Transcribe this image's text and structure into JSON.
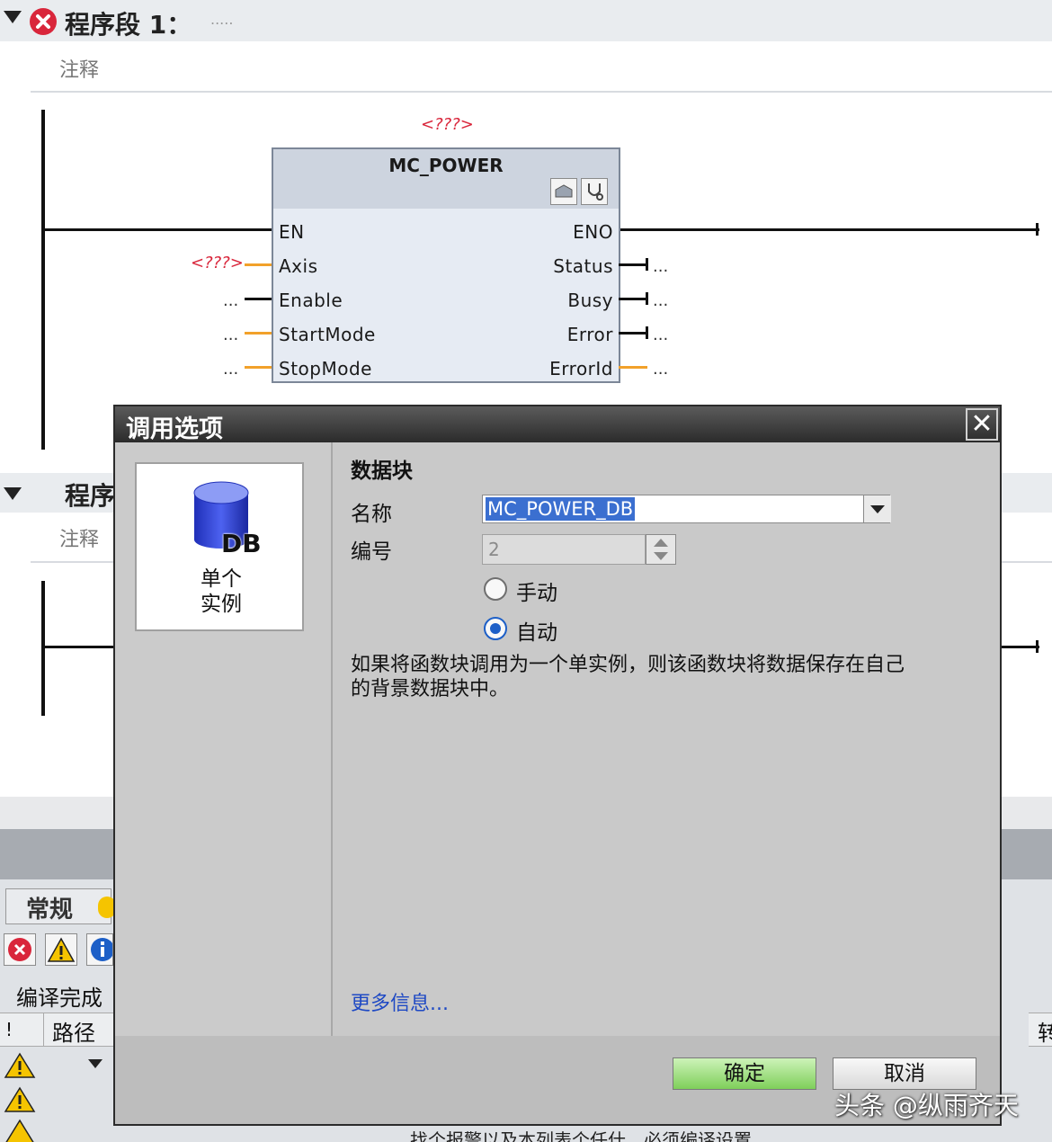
{
  "segment1": {
    "title": "程序段 1：",
    "ellipsis": ".....",
    "comment": "注释"
  },
  "segment2": {
    "title": "程序",
    "comment": "注释"
  },
  "block": {
    "instance_placeholder": "<???>",
    "name": "MC_POWER",
    "inputs": [
      "EN",
      "Axis",
      "Enable",
      "StartMode",
      "StopMode"
    ],
    "outputs": [
      "ENO",
      "Status",
      "Busy",
      "Error",
      "ErrorId"
    ],
    "axis_value": "<???>",
    "input_values": [
      "...",
      "...",
      "..."
    ],
    "output_values": [
      "...",
      "...",
      "...",
      "..."
    ]
  },
  "dialog": {
    "title": "调用选项",
    "close_label": "✕",
    "tile_label_line1": "单个",
    "tile_label_line2": "实例",
    "db_text": "DB",
    "section_title": "数据块",
    "name_label": "名称",
    "name_value": "MC_POWER_DB",
    "number_label": "编号",
    "number_value": "2",
    "manual_label": "手动",
    "auto_label": "自动",
    "selected_mode": "auto",
    "description_line1": "如果将函数块调用为一个单实例，则该函数块将数据保存在自己",
    "description_line2": "的背景数据块中。",
    "more_info": "更多信息...",
    "ok_label": "确定",
    "cancel_label": "取消"
  },
  "inspector": {
    "tab_general": "常规",
    "compile_done": "编译完成",
    "col_bang": "!",
    "col_path": "路径",
    "right_cut": "转"
  },
  "bottom_message": "找个报警以及本列表个任什。必须编译设置。",
  "watermark": "头条 @纵雨齐天",
  "colors": {
    "accent_ok": "#7fcf5a",
    "selection": "#3b6fd0",
    "error": "#d9263b",
    "warning": "#f5c400",
    "orange_wire": "#f2a12a"
  }
}
